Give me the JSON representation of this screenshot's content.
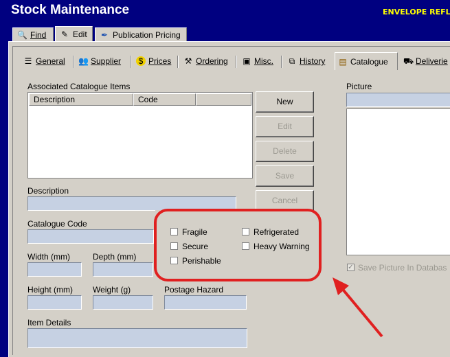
{
  "window": {
    "title": "Stock Maintenance",
    "subtitle": "ENVELOPE REFLE"
  },
  "top_tabs": [
    {
      "label": "Find",
      "icon": "search-icon"
    },
    {
      "label": "Edit",
      "icon": "pencil-icon"
    },
    {
      "label": "Publication Pricing",
      "icon": "pen-icon"
    }
  ],
  "sub_tabs": [
    {
      "label": "General",
      "icon": "list-icon"
    },
    {
      "label": "Supplier",
      "icon": "people-icon"
    },
    {
      "label": "Prices",
      "icon": "coin-icon"
    },
    {
      "label": "Ordering",
      "icon": "hammer-icon"
    },
    {
      "label": "Misc.",
      "icon": "window-icon"
    },
    {
      "label": "History",
      "icon": "copy-icon"
    },
    {
      "label": "Catalogue",
      "icon": "catalogue-icon"
    },
    {
      "label": "Deliverie",
      "icon": "delivery-icon"
    }
  ],
  "catalogue": {
    "items_label": "Associated Catalogue Items",
    "columns": [
      "Description",
      "Code"
    ],
    "buttons": {
      "new": "New",
      "edit": "Edit",
      "delete": "Delete",
      "save": "Save",
      "cancel": "Cancel"
    },
    "description_label": "Description",
    "code_label": "Catalogue Code",
    "width_label": "Width (mm)",
    "depth_label": "Depth (mm)",
    "height_label": "Height (mm)",
    "weight_label": "Weight (g)",
    "postage_label": "Postage Hazard",
    "details_label": "Item Details",
    "checkboxes": {
      "fragile": "Fragile",
      "secure": "Secure",
      "perishable": "Perishable",
      "refrigerated": "Refrigerated",
      "heavy": "Heavy Warning"
    },
    "picture_label": "Picture",
    "save_picture_label": "Save Picture In Databas"
  },
  "colors": {
    "titlebar": "#000080",
    "annotation": "#e02020",
    "field": "#c6d1e3",
    "subtitle": "#ffff00"
  }
}
